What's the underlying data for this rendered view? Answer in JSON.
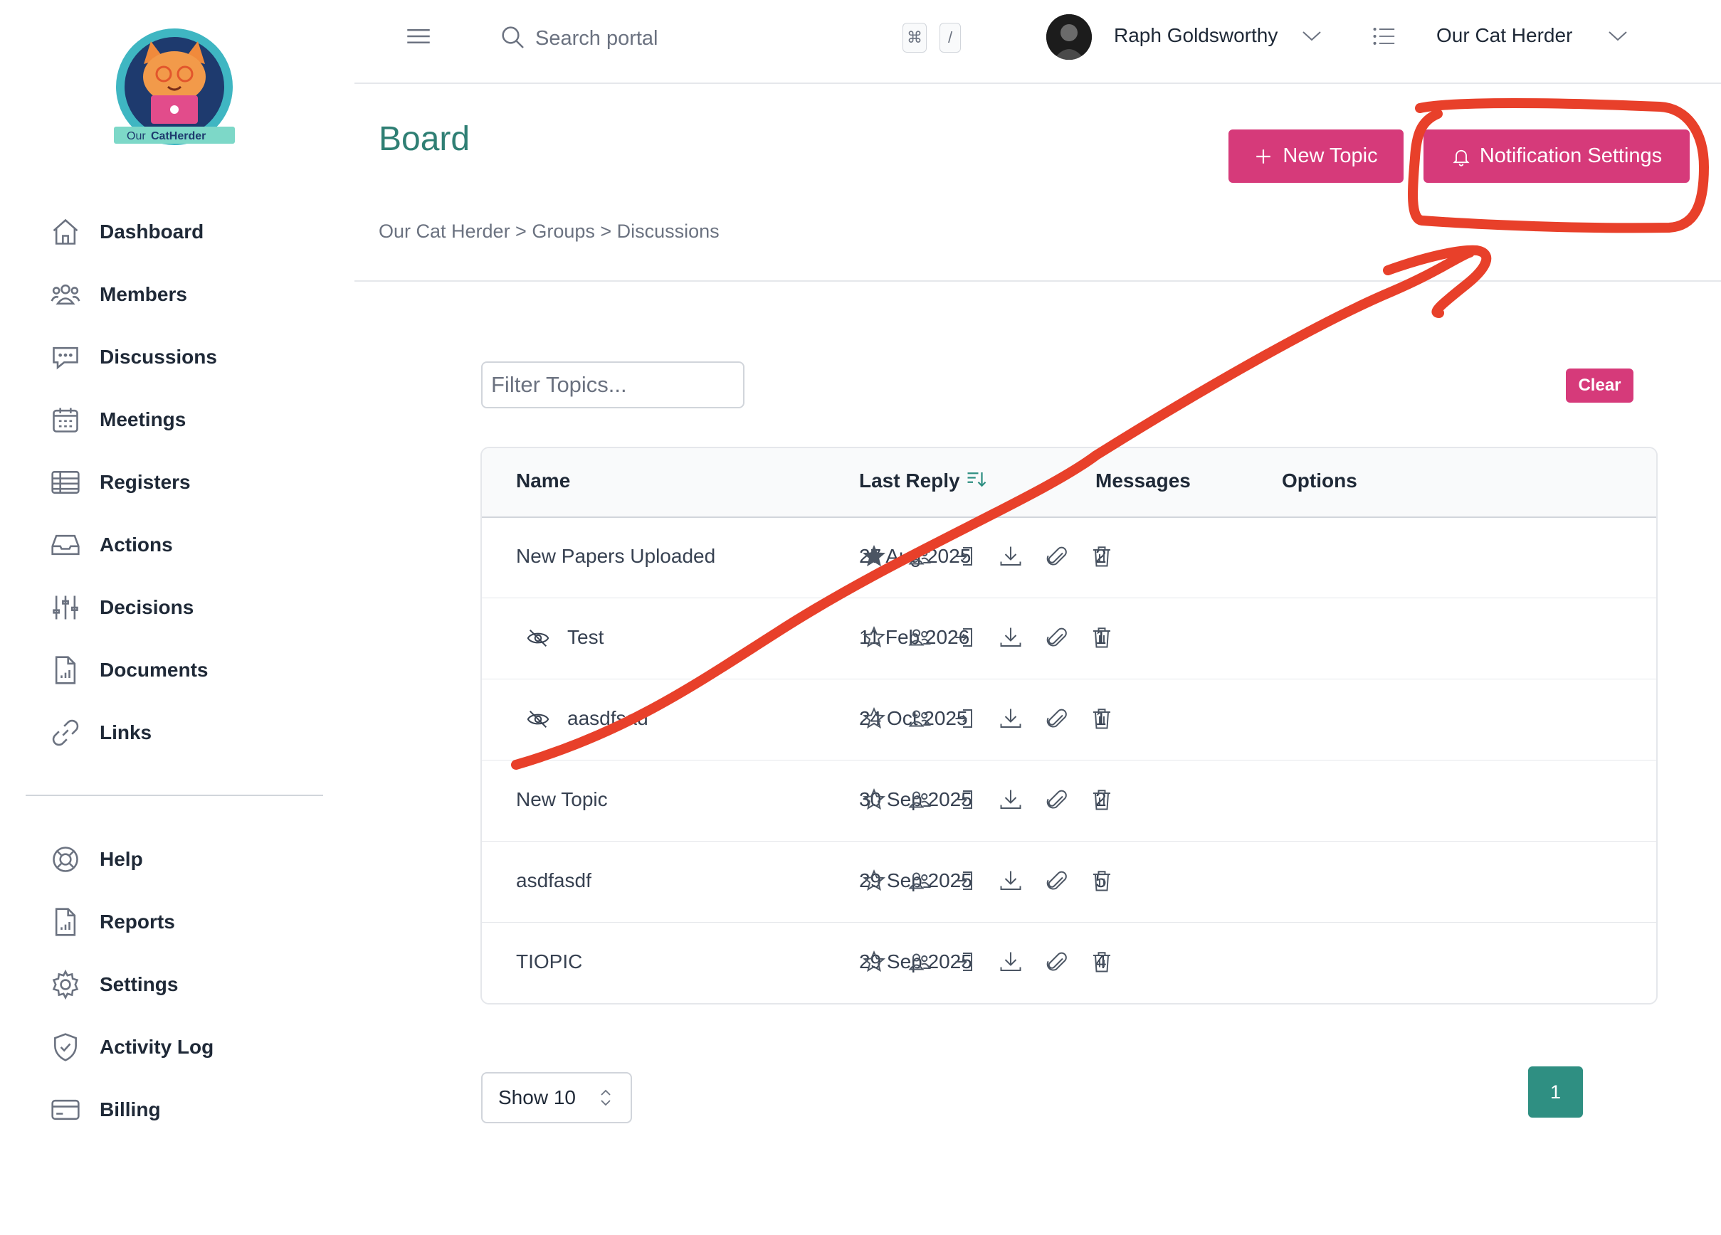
{
  "brand": {
    "logo_text_our": "Our",
    "logo_text_name": "CatHerder"
  },
  "sidebar": {
    "items": [
      {
        "label": "Dashboard",
        "icon": "home-icon"
      },
      {
        "label": "Members",
        "icon": "users-icon"
      },
      {
        "label": "Discussions",
        "icon": "chat-icon"
      },
      {
        "label": "Meetings",
        "icon": "calendar-icon"
      },
      {
        "label": "Registers",
        "icon": "table-icon"
      },
      {
        "label": "Actions",
        "icon": "inbox-icon"
      },
      {
        "label": "Decisions",
        "icon": "sliders-icon"
      },
      {
        "label": "Documents",
        "icon": "document-icon"
      },
      {
        "label": "Links",
        "icon": "link-icon"
      }
    ],
    "secondary": [
      {
        "label": "Help",
        "icon": "lifebuoy-icon"
      },
      {
        "label": "Reports",
        "icon": "report-icon"
      },
      {
        "label": "Settings",
        "icon": "gear-icon"
      },
      {
        "label": "Activity Log",
        "icon": "shield-icon"
      },
      {
        "label": "Billing",
        "icon": "credit-card-icon"
      }
    ]
  },
  "header": {
    "search_placeholder": "Search portal",
    "shortcut_keys": [
      "⌘",
      "/"
    ],
    "user_name": "Raph Goldsworthy",
    "org_name": "Our Cat Herder"
  },
  "page": {
    "title": "Board",
    "new_topic_label": "New Topic",
    "notification_settings_label": "Notification Settings",
    "breadcrumb": "Our Cat Herder > Groups > Discussions",
    "filter_placeholder": "Filter Topics...",
    "clear_label": "Clear"
  },
  "table": {
    "columns": [
      "Name",
      "Last Reply",
      "Messages",
      "Options"
    ],
    "rows": [
      {
        "name": "New Papers Uploaded",
        "last_reply": "27 Aug 2025",
        "messages": "2",
        "hidden": false,
        "starred": true
      },
      {
        "name": "Test",
        "last_reply": "11 Feb 2026",
        "messages": "1",
        "hidden": true,
        "starred": false
      },
      {
        "name": "aasdfsad",
        "last_reply": "24 Oct 2025",
        "messages": "1",
        "hidden": true,
        "starred": false
      },
      {
        "name": "New Topic",
        "last_reply": "30 Sep 2025",
        "messages": "2",
        "hidden": false,
        "starred": false
      },
      {
        "name": "asdfasdf",
        "last_reply": "29 Sep 2025",
        "messages": "5",
        "hidden": false,
        "starred": false
      },
      {
        "name": "TIOPIC",
        "last_reply": "29 Sep 2025",
        "messages": "4",
        "hidden": false,
        "starred": false
      }
    ],
    "option_icons": [
      "star-icon",
      "members-icon",
      "move-icon",
      "download-icon",
      "attachment-icon",
      "trash-icon"
    ]
  },
  "pagination": {
    "show_label": "Show 10",
    "current_page": "1"
  },
  "colors": {
    "accent_pink": "#d63a7a",
    "brand_teal": "#2f7f74",
    "annotation_red": "#e8402a"
  }
}
